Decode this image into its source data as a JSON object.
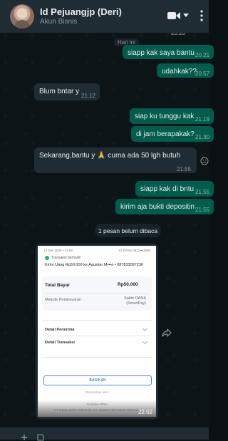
{
  "header": {
    "contact_name": "Id Pejuangjp (Deri)",
    "subtitle": "Akun Bisnis",
    "icons": [
      "video-call-icon",
      "chevron-down-icon",
      "more-options-icon"
    ]
  },
  "chat": {
    "date_label": "Hari ini",
    "partial_time_top": "20.20",
    "messages": [
      {
        "dir": "out",
        "text": "siapp kak saya bantu",
        "time": "20.21"
      },
      {
        "dir": "out",
        "text": "udahkak??",
        "time": "20.57"
      },
      {
        "dir": "in",
        "text": "Blum bntar y",
        "time": "21.12"
      },
      {
        "dir": "out",
        "text": "siap ku tunggu kak",
        "time": "21.19"
      },
      {
        "dir": "out",
        "text": "di jam berapakak?",
        "time": "21.30"
      },
      {
        "dir": "in",
        "text": "Sekarang,bantu y 🙏 cuma ada 50 lgh butuh",
        "time": "21.55"
      },
      {
        "dir": "out",
        "text": "siapp kak di bntu",
        "time": "21.55"
      },
      {
        "dir": "out",
        "text": "kirim aja bukti depositin",
        "time": "21.55"
      }
    ],
    "unread_label": "1 pesan belum dibaca",
    "image_message": {
      "time": "22.02",
      "receipt": {
        "datetime": "14 Des 2025 • 21:59",
        "id": "ID DANA 0831•••2505",
        "status": "Transaksi berhasil!",
        "transfer": "Kirim Uang Rp50.000 ke Agustiar M•••e • 087833097236",
        "total_label": "Total Bayar",
        "total_value": "Rp50.000",
        "method_label": "Metode Pembayaran",
        "method_value": "Saldo DANA (SmartPay)",
        "section1": "Detail Penerima",
        "section2": "Detail Transaksi",
        "button": "BAGIKAN",
        "footer1": "Diamankan oleh",
        "footer2": "Terdaftar PPNI",
        "footer3": "PT Espay Debit Indonesia Koe diawasi oleh Bank Indonesia"
      }
    }
  },
  "composer": {
    "icons": [
      "plus-icon",
      "sticker-icon"
    ]
  }
}
